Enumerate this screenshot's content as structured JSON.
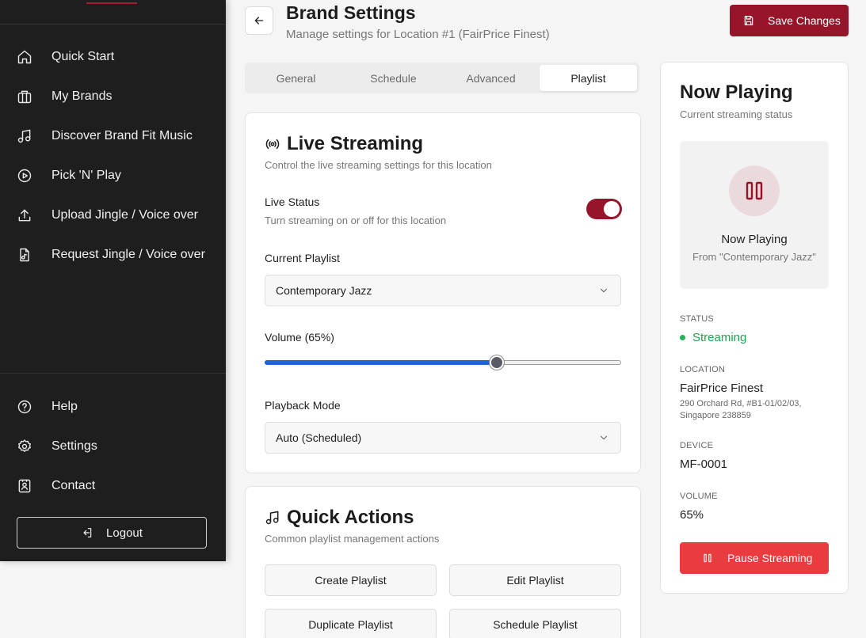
{
  "sidebar": {
    "items": [
      {
        "label": "Quick Start",
        "icon": "home-icon"
      },
      {
        "label": "My Brands",
        "icon": "building-icon"
      },
      {
        "label": "Discover Brand Fit Music",
        "icon": "music-note-icon"
      },
      {
        "label": "Pick 'N' Play",
        "icon": "play-circle-icon"
      },
      {
        "label": "Upload Jingle / Voice over",
        "icon": "upload-icon"
      },
      {
        "label": "Request Jingle / Voice over",
        "icon": "file-audio-icon"
      }
    ],
    "bottom_items": [
      {
        "label": "Help",
        "icon": "help-circle-icon"
      },
      {
        "label": "Settings",
        "icon": "gear-icon"
      },
      {
        "label": "Contact",
        "icon": "contact-card-icon"
      }
    ],
    "logout_label": "Logout",
    "accent_color": "#a51c30"
  },
  "header": {
    "title": "Brand Settings",
    "subtitle": "Manage settings for Location #1 (FairPrice Finest)",
    "save_label": "Save Changes"
  },
  "tabs": [
    {
      "label": "General",
      "active": false
    },
    {
      "label": "Schedule",
      "active": false
    },
    {
      "label": "Advanced",
      "active": false
    },
    {
      "label": "Playlist",
      "active": true
    }
  ],
  "live_streaming": {
    "title": "Live Streaming",
    "description": "Control the live streaming settings for this location",
    "live_status_label": "Live Status",
    "live_status_help": "Turn streaming on or off for this location",
    "live_status_on": true,
    "current_playlist_label": "Current Playlist",
    "current_playlist_value": "Contemporary Jazz",
    "volume_label": "Volume (65%)",
    "volume_percent": 65,
    "playback_mode_label": "Playback Mode",
    "playback_mode_value": "Auto (Scheduled)"
  },
  "quick_actions": {
    "title": "Quick Actions",
    "description": "Common playlist management actions",
    "buttons": [
      "Create Playlist",
      "Edit Playlist",
      "Duplicate Playlist",
      "Schedule Playlist"
    ]
  },
  "now_playing": {
    "title": "Now Playing",
    "subtitle": "Current streaming status",
    "box_title": "Now Playing",
    "box_subtitle": "From \"Contemporary Jazz\"",
    "status_label": "STATUS",
    "status_value": "Streaming",
    "location_label": "LOCATION",
    "location_name": "FairPrice Finest",
    "location_address": "290 Orchard Rd, #B1-01/02/03, Singapore 238859",
    "device_label": "DEVICE",
    "device_value": "MF-0001",
    "volume_label": "VOLUME",
    "volume_value": "65%",
    "pause_label": "Pause Streaming",
    "status_color": "#1fa34e",
    "pause_color": "#ea3b3f",
    "brand_color": "#97152b"
  }
}
